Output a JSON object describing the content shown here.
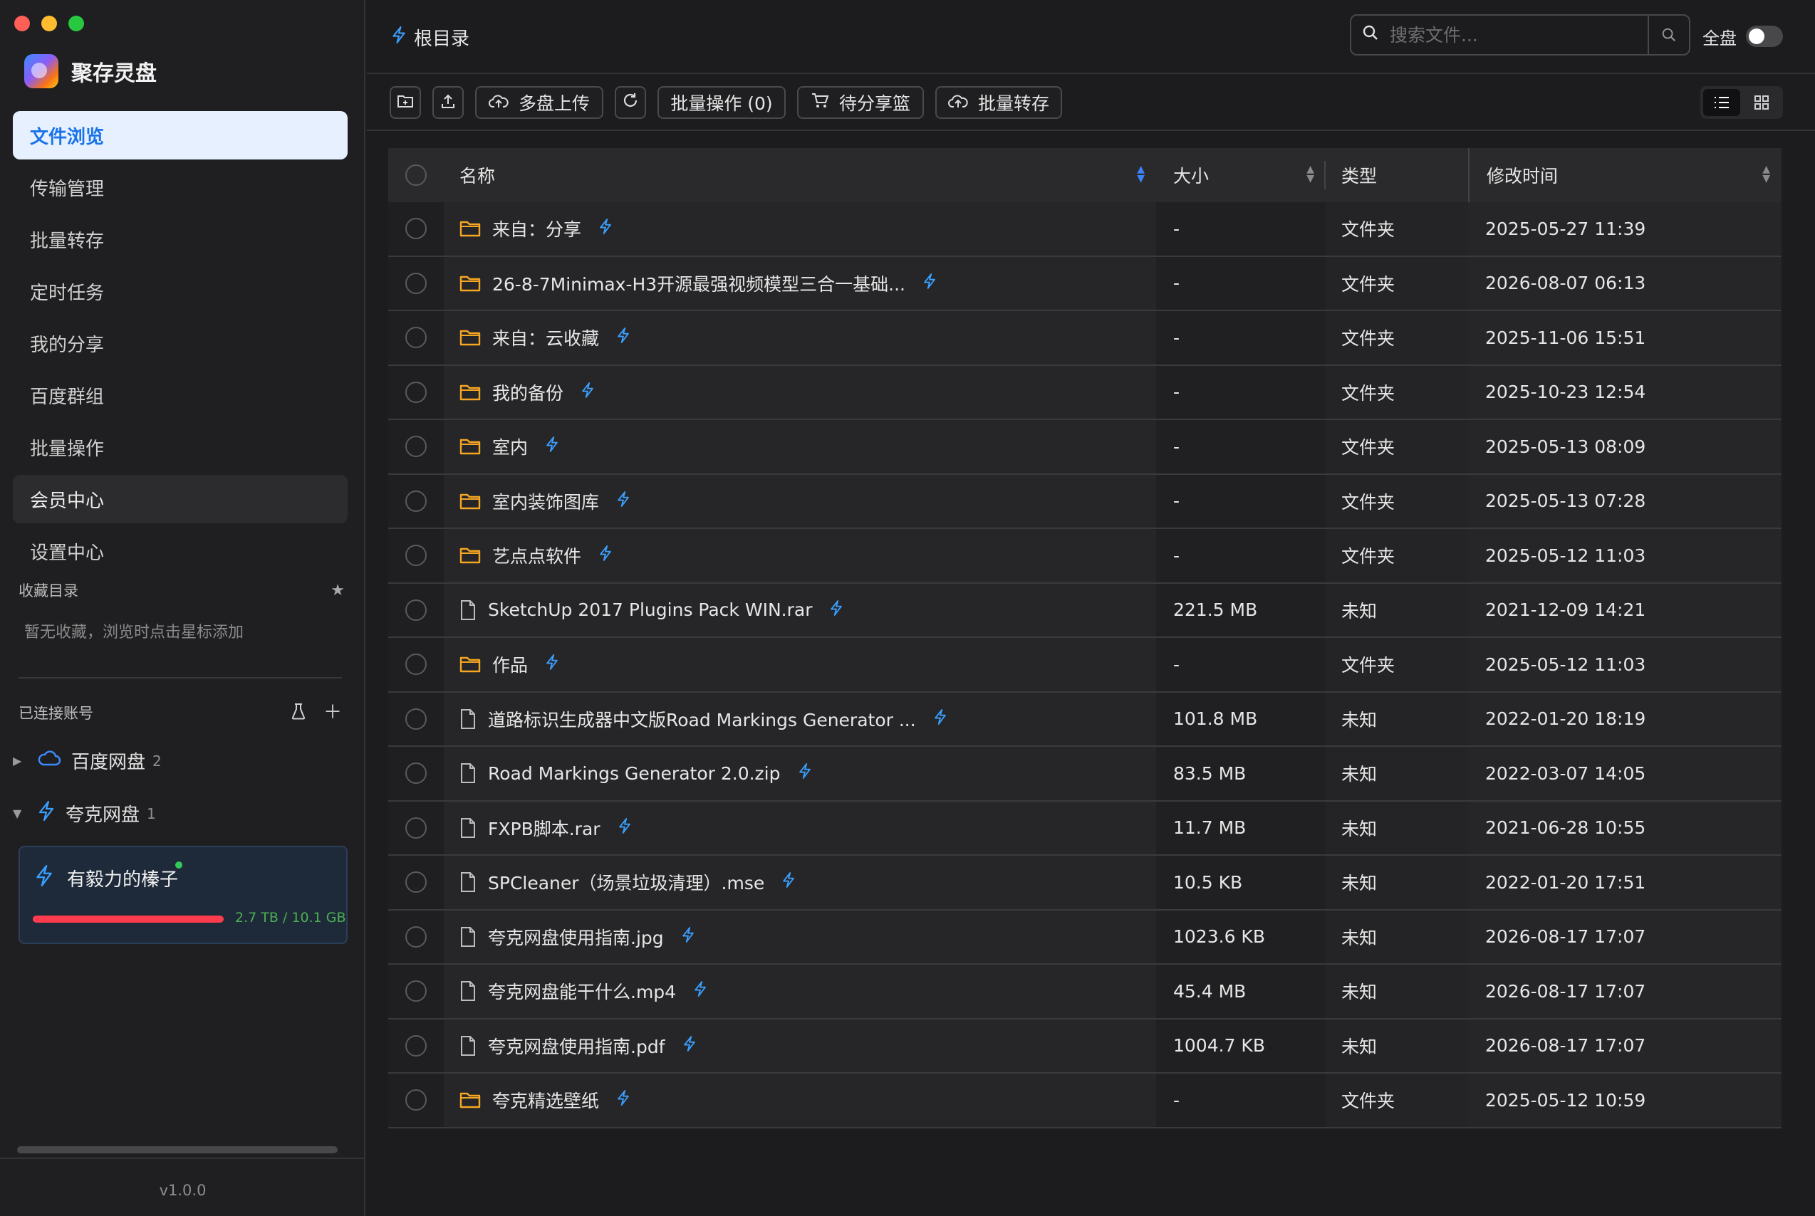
{
  "app": {
    "name": "聚存灵盘",
    "version": "v1.0.0"
  },
  "nav": {
    "items": [
      {
        "label": "文件浏览",
        "state": "active"
      },
      {
        "label": "传输管理",
        "state": ""
      },
      {
        "label": "批量转存",
        "state": ""
      },
      {
        "label": "定时任务",
        "state": ""
      },
      {
        "label": "我的分享",
        "state": ""
      },
      {
        "label": "百度群组",
        "state": ""
      },
      {
        "label": "批量操作",
        "state": ""
      },
      {
        "label": "会员中心",
        "state": "hover"
      },
      {
        "label": "设置中心",
        "state": ""
      }
    ]
  },
  "favorites": {
    "title": "收藏目录",
    "empty": "暂无收藏，浏览时点击星标添加"
  },
  "accounts": {
    "title": "已连接账号",
    "baidu": {
      "label": "百度网盘",
      "count": "2"
    },
    "quark": {
      "label": "夸克网盘",
      "count": "1"
    },
    "active_user": {
      "name": "有毅力的榛子",
      "quota": "2.7 TB / 10.1 GB",
      "quota_fill": 1.0
    }
  },
  "topbar": {
    "breadcrumb": "根目录",
    "search_placeholder": "搜索文件...",
    "fulldisk_label": "全盘",
    "fulldisk_on": false
  },
  "toolbar": {
    "multi_upload": "多盘上传",
    "batch_ops": "批量操作 (0)",
    "share_basket": "待分享篮",
    "batch_transfer": "批量转存"
  },
  "table": {
    "headers": {
      "name": "名称",
      "size": "大小",
      "type": "类型",
      "modified": "修改时间"
    },
    "rows": [
      {
        "name": "来自：分享",
        "size": "-",
        "type": "文件夹",
        "modified": "2025-05-27 11:39",
        "kind": "folder"
      },
      {
        "name": "26-8-7Minimax-H3开源最强视频模型三合一基础...",
        "size": "-",
        "type": "文件夹",
        "modified": "2026-08-07 06:13",
        "kind": "folder"
      },
      {
        "name": "来自：云收藏",
        "size": "-",
        "type": "文件夹",
        "modified": "2025-11-06 15:51",
        "kind": "folder"
      },
      {
        "name": "我的备份",
        "size": "-",
        "type": "文件夹",
        "modified": "2025-10-23 12:54",
        "kind": "folder"
      },
      {
        "name": "室内",
        "size": "-",
        "type": "文件夹",
        "modified": "2025-05-13 08:09",
        "kind": "folder"
      },
      {
        "name": "室内装饰图库",
        "size": "-",
        "type": "文件夹",
        "modified": "2025-05-13 07:28",
        "kind": "folder"
      },
      {
        "name": "艺点点软件",
        "size": "-",
        "type": "文件夹",
        "modified": "2025-05-12 11:03",
        "kind": "folder"
      },
      {
        "name": "SketchUp 2017 Plugins Pack WIN.rar",
        "size": "221.5 MB",
        "type": "未知",
        "modified": "2021-12-09 14:21",
        "kind": "file"
      },
      {
        "name": "作品",
        "size": "-",
        "type": "文件夹",
        "modified": "2025-05-12 11:03",
        "kind": "folder"
      },
      {
        "name": "道路标识生成器中文版Road Markings Generator ...",
        "size": "101.8 MB",
        "type": "未知",
        "modified": "2022-01-20 18:19",
        "kind": "file"
      },
      {
        "name": "Road Markings Generator 2.0.zip",
        "size": "83.5 MB",
        "type": "未知",
        "modified": "2022-03-07 14:05",
        "kind": "file"
      },
      {
        "name": "FXPB脚本.rar",
        "size": "11.7 MB",
        "type": "未知",
        "modified": "2021-06-28 10:55",
        "kind": "file"
      },
      {
        "name": "SPCleaner（场景垃圾清理）.mse",
        "size": "10.5 KB",
        "type": "未知",
        "modified": "2022-01-20 17:51",
        "kind": "file"
      },
      {
        "name": "夸克网盘使用指南.jpg",
        "size": "1023.6 KB",
        "type": "未知",
        "modified": "2026-08-17 17:07",
        "kind": "file"
      },
      {
        "name": "夸克网盘能干什么.mp4",
        "size": "45.4 MB",
        "type": "未知",
        "modified": "2026-08-17 17:07",
        "kind": "file"
      },
      {
        "name": "夸克网盘使用指南.pdf",
        "size": "1004.7 KB",
        "type": "未知",
        "modified": "2026-08-17 17:07",
        "kind": "file"
      },
      {
        "name": "夸克精选壁纸",
        "size": "-",
        "type": "文件夹",
        "modified": "2025-05-12 10:59",
        "kind": "folder"
      }
    ]
  },
  "colors": {
    "accent": "#1a73e8",
    "bolt": "#3aa0ff",
    "folder": "#f5a623",
    "quota": "#ff3b4e",
    "quota_text": "#4caf50",
    "online": "#34c759"
  },
  "icons": {
    "star": "star-icon",
    "bolt": "bolt-icon",
    "cloud": "cloud-icon",
    "folder": "folder-icon",
    "file": "file-icon",
    "search": "search-icon"
  }
}
